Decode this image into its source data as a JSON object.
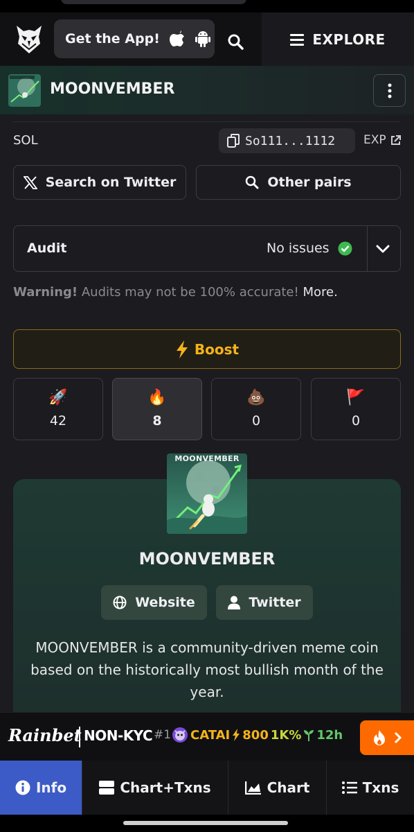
{
  "nav": {
    "get_app_label": "Get the App!",
    "explore_label": "EXPLORE"
  },
  "token": {
    "name": "MOONVEMBER",
    "chain": "SOL",
    "address_short": "So111...1112",
    "explorer_label": "EXP"
  },
  "actions": {
    "twitter_search_label": "Search on Twitter",
    "other_pairs_label": "Other pairs"
  },
  "audit": {
    "label": "Audit",
    "status": "No issues",
    "warning_strong": "Warning!",
    "warning_text": " Audits may not be 100% accurate! ",
    "warning_more": "More."
  },
  "boost": {
    "label": "Boost"
  },
  "reactions": [
    {
      "icon": "rocket-icon",
      "emoji": "🚀",
      "count": "42"
    },
    {
      "icon": "fire-icon",
      "emoji": "🔥",
      "count": "8"
    },
    {
      "icon": "poop-icon",
      "emoji": "💩",
      "count": "0"
    },
    {
      "icon": "flag-icon",
      "emoji": "🚩",
      "count": "0"
    }
  ],
  "card": {
    "image_text": "MOONVEMBER",
    "title": "MOONVEMBER",
    "website_label": "Website",
    "twitter_label": "Twitter",
    "description": "MOONVEMBER is a community-driven meme coin based on the historically most bullish month of the year."
  },
  "ad": {
    "brand": "Rainbet",
    "tag": "NON-KYC",
    "rank": "#1",
    "ticker": "CATAI",
    "boosts": "800",
    "pct": "1K%",
    "age": "12h"
  },
  "tabs": [
    {
      "label": "Info",
      "icon": "info-icon"
    },
    {
      "label": "Chart+Txns",
      "icon": "layout-icon"
    },
    {
      "label": "Chart",
      "icon": "chart-icon"
    },
    {
      "label": "Txns",
      "icon": "list-icon"
    }
  ],
  "colors": {
    "accent_blue": "#3d5bc7",
    "boost_gold": "#f4b31a",
    "success_green": "#3fb950",
    "ad_orange": "#ff6a00"
  }
}
